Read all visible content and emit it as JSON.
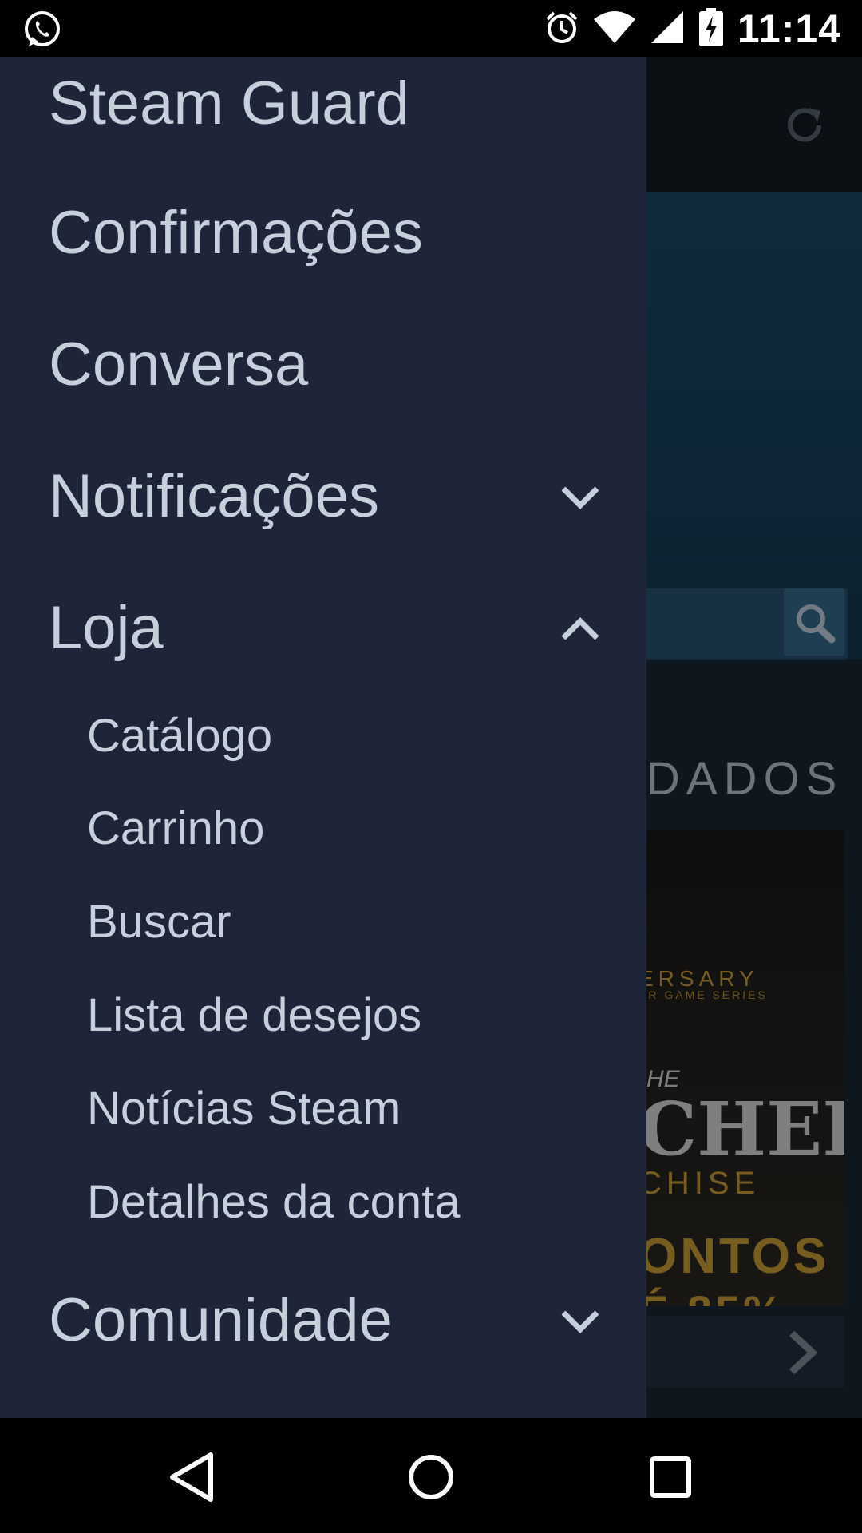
{
  "status_bar": {
    "time": "11:14",
    "icons": [
      "whatsapp-icon",
      "alarm-icon",
      "wifi-icon",
      "signal-icon",
      "battery-charging-icon"
    ]
  },
  "background": {
    "section_partial": "DADOS",
    "game_lines": [
      "ERSARY",
      "ER GAME SERIES",
      "HE",
      "CHER",
      "CHISE",
      "ONTOS",
      "É 85%"
    ]
  },
  "drawer": {
    "items": [
      {
        "label": "Steam Guard"
      },
      {
        "label": "Confirmações"
      },
      {
        "label": "Conversa"
      },
      {
        "label": "Notificações",
        "expander": "chevron-down-icon"
      },
      {
        "label": "Loja",
        "expander": "chevron-up-icon"
      }
    ],
    "store_subitems": [
      {
        "label": "Catálogo"
      },
      {
        "label": "Carrinho"
      },
      {
        "label": "Buscar"
      },
      {
        "label": "Lista de desejos"
      },
      {
        "label": "Notícias Steam"
      },
      {
        "label": "Detalhes da conta"
      }
    ],
    "community": {
      "label": "Comunidade",
      "expander": "chevron-down-icon"
    }
  },
  "nav_bar": {
    "buttons": [
      "back-icon",
      "home-icon",
      "recents-icon"
    ]
  },
  "colors": {
    "drawer_bg": "#1e2538",
    "text": "#c6cfdc",
    "status_bar_bg": "#000000"
  }
}
